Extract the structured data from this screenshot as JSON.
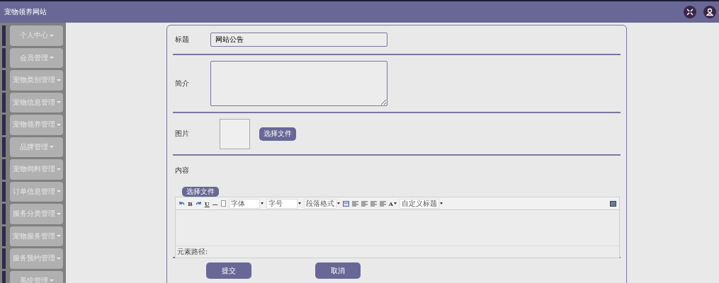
{
  "header": {
    "title": "宠物领养网站"
  },
  "sidebar": {
    "items": [
      {
        "label": "个人中心"
      },
      {
        "label": "会员管理"
      },
      {
        "label": "宠物类别管理"
      },
      {
        "label": "宠物信息管理"
      },
      {
        "label": "宠物领养管理"
      },
      {
        "label": "品牌管理"
      },
      {
        "label": "宠物饲料管理"
      },
      {
        "label": "订单信息管理"
      },
      {
        "label": "服务分类管理"
      },
      {
        "label": "宠物服务管理"
      },
      {
        "label": "服务预约管理"
      },
      {
        "label": "系统管理"
      }
    ]
  },
  "form": {
    "title_label": "标题",
    "title_value": "网站公告",
    "summary_label": "简介",
    "image_label": "图片",
    "image_button": "选择文件",
    "content_label": "内容",
    "content_button": "选择文件",
    "toolbar": [
      {
        "kind": "undo"
      },
      {
        "kind": "text",
        "text": "B"
      },
      {
        "kind": "redo"
      },
      {
        "kind": "underline",
        "text": "U"
      },
      {
        "kind": "text",
        "text": "—"
      },
      {
        "kind": "page"
      },
      {
        "kind": "select",
        "text": "字体"
      },
      {
        "kind": "select",
        "text": "字号"
      },
      {
        "kind": "select",
        "text": "段落格式"
      },
      {
        "kind": "table"
      },
      {
        "kind": "align"
      },
      {
        "kind": "align"
      },
      {
        "kind": "align"
      },
      {
        "kind": "align"
      },
      {
        "kind": "text_menu",
        "text": "A"
      },
      {
        "kind": "select",
        "text": "自定义标题"
      }
    ],
    "element_path": "元素路径:",
    "submit": "提交",
    "cancel": "取消"
  }
}
